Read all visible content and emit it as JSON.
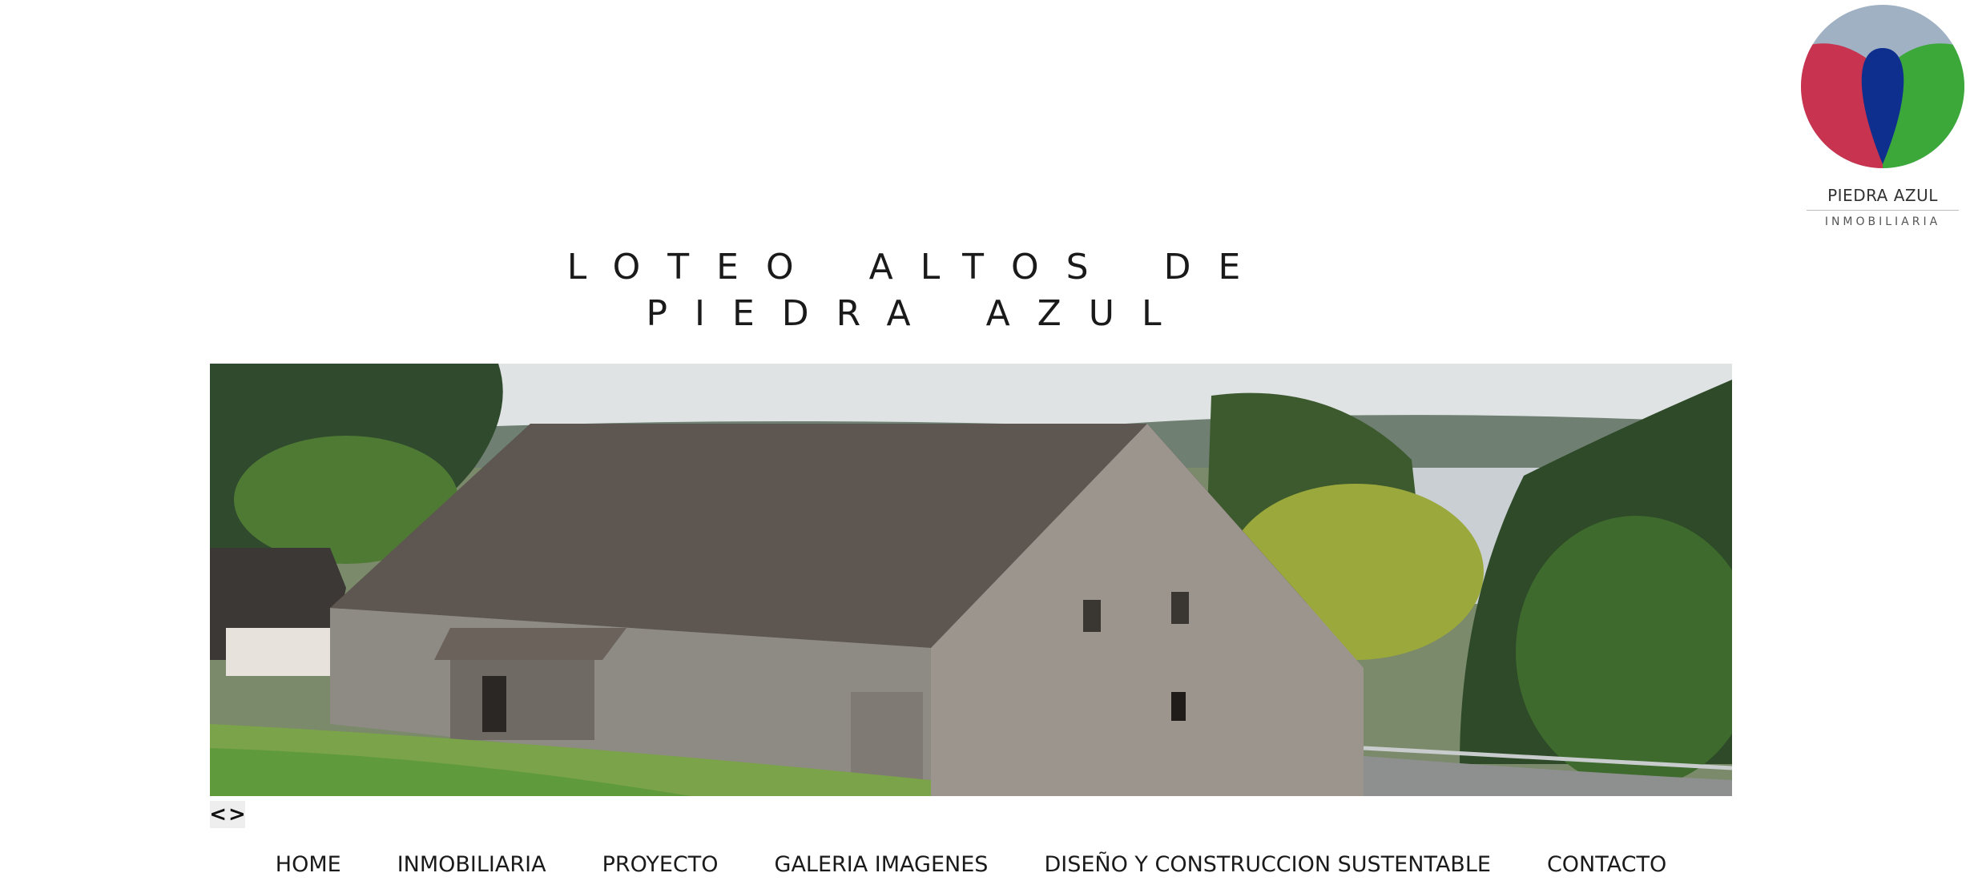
{
  "logo": {
    "name": "PIEDRA AZUL",
    "subtitle": "INMOBILIARIA",
    "icon": "balloon-logo-icon",
    "colors": {
      "sky": "#9fb1c2",
      "red": "#c8334f",
      "blue": "#0f2f8f",
      "green": "#3ca83a"
    }
  },
  "title": {
    "line1_word1": "LOTEO",
    "line1_word2": "ALTOS",
    "line1_word3": "DE",
    "line2_word1": "PIEDRA",
    "line2_word2": "AZUL"
  },
  "slider": {
    "image_icon": "barn-landscape-photo",
    "prev_label": "<",
    "next_label": ">"
  },
  "nav": {
    "items": [
      {
        "label": "HOME"
      },
      {
        "label": "INMOBILIARIA"
      },
      {
        "label": "PROYECTO"
      },
      {
        "label": "GALERIA IMAGENES"
      },
      {
        "label": "DISEÑO Y CONSTRUCCION SUSTENTABLE"
      },
      {
        "label": "CONTACTO"
      }
    ]
  }
}
